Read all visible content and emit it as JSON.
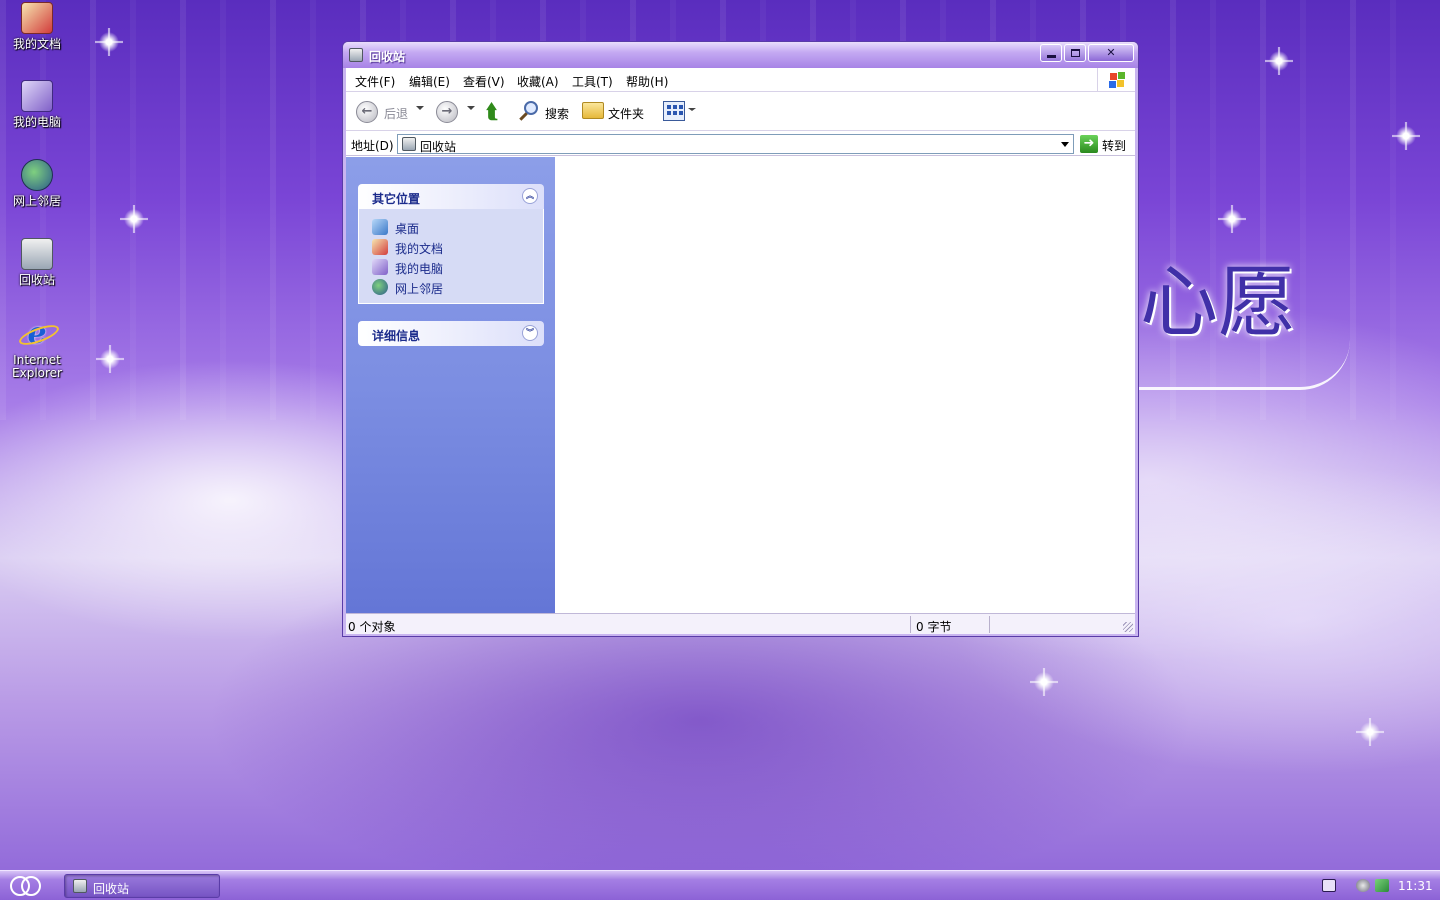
{
  "desktop": {
    "icons": [
      {
        "label": "我的文档",
        "icon": "my-documents-icon"
      },
      {
        "label": "我的电脑",
        "icon": "my-computer-icon"
      },
      {
        "label": "网上邻居",
        "icon": "network-places-icon"
      },
      {
        "label": "回收站",
        "icon": "recycle-bin-icon"
      },
      {
        "label_line1": "Internet",
        "label_line2": "Explorer",
        "icon": "internet-explorer-icon"
      }
    ],
    "wallpaper_text": "心愿"
  },
  "window": {
    "title": "回收站",
    "menu": [
      "文件(F)",
      "编辑(E)",
      "查看(V)",
      "收藏(A)",
      "工具(T)",
      "帮助(H)"
    ],
    "toolbar": {
      "back": "后退",
      "search": "搜索",
      "folders": "文件夹"
    },
    "address": {
      "label": "地址(D)",
      "value": "回收站",
      "go": "转到"
    },
    "taskpane": {
      "other_places": {
        "title": "其它位置",
        "items": [
          "桌面",
          "我的文档",
          "我的电脑",
          "网上邻居"
        ]
      },
      "details": {
        "title": "详细信息"
      }
    },
    "status": {
      "objects": "0 个对象",
      "size": "0 字节"
    }
  },
  "taskbar": {
    "task_label": "回收站",
    "clock": "11:31"
  },
  "colors": {
    "accent": "#a783e6",
    "taskpane": "#7c8ee2",
    "link": "#1c2c8c"
  }
}
